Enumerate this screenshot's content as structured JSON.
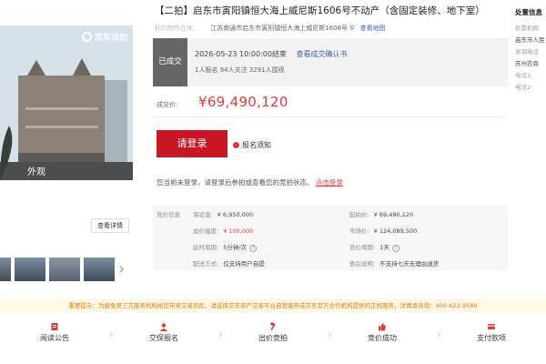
{
  "gallery": {
    "watermark": "京东法拍",
    "caption": "外观",
    "view_detail_label": "查看详情"
  },
  "listing": {
    "title": "【二拍】启东市寅阳镇恒大海上威尼斯1606号不动产（含固定装修、地下室）",
    "subject_label": "标的物所在地：",
    "subject_address": "江苏南通市启东市寅阳镇恒大海上威尼斯1606号",
    "map_link": "查看地图"
  },
  "status": {
    "badge": "已成交",
    "end_time": "2026-05-23 10:00:00结束",
    "confirmation_link": "查看成交确认书",
    "counts": "1人报名  94人关注  3291人围观"
  },
  "price": {
    "label": "成交价:",
    "value": "¥69,490,120"
  },
  "actions": {
    "login_button": "请登录",
    "notice_link": "报名须知",
    "login_tip": "您当前未登录，请登录后参拍或查看您的竞拍状态。",
    "login_tip_link": "点击登录"
  },
  "info": {
    "section_label": "竞价信息",
    "rows": [
      {
        "k": "保证金:",
        "v": "¥ 6,950,000",
        "red": false
      },
      {
        "k": "起拍价:",
        "v": "¥ 69,490,120",
        "red": false
      },
      {
        "k": "加价幅度:",
        "v": "¥ 100,000",
        "red": true
      },
      {
        "k": "市场价:",
        "v": "¥ 124,089,500",
        "red": false
      },
      {
        "k": "延时周期:",
        "v": "5分钟/次",
        "red": false
      },
      {
        "k": "竞价周期:",
        "v": "1天",
        "red": false
      },
      {
        "k": "配送方式:",
        "v": "仅支持用户自提",
        "red": false
      },
      {
        "k": "售后说明:",
        "v": "不支持七天无理由退货",
        "red": false
      }
    ]
  },
  "right_col": {
    "title": "处置信息",
    "lines": [
      {
        "k": "处置机构",
        "v": ""
      },
      {
        "k": "",
        "v": "启东市人民"
      },
      {
        "k": "咨询电话",
        "v": ""
      },
      {
        "k": "",
        "v": "苏州农商"
      },
      {
        "k": "电话1:",
        "v": ""
      },
      {
        "k": "电话2:",
        "v": ""
      }
    ]
  },
  "warning": "重要提示：为避免第三方服务机构给您带来交易风险，请选择京东资产交易平台自营服务或京东官方合作机构提供的正规服务，详情请咨询：400-622-9586",
  "steps": [
    {
      "label": "阅读公告",
      "icon": "document-icon"
    },
    {
      "label": "交保报名",
      "icon": "user-icon"
    },
    {
      "label": "出价竞拍",
      "icon": "hammer-icon"
    },
    {
      "label": "竞价成功",
      "icon": "thumb-up-icon"
    },
    {
      "label": "支付款项",
      "icon": "payment-icon"
    }
  ],
  "colors": {
    "accent": "#c81623",
    "price": "#e4393c",
    "link": "#3c64b4"
  }
}
